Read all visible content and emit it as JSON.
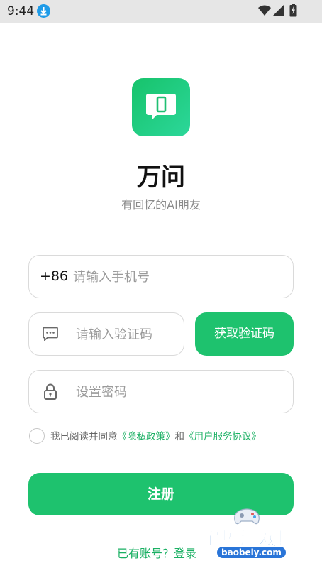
{
  "status_bar": {
    "time": "9:44",
    "download_icon": "download-circle-icon",
    "wifi_icon": "wifi-icon",
    "signal_icon": "signal-icon",
    "battery_icon": "battery-charging-icon"
  },
  "app": {
    "name": "万问",
    "slogan": "有回忆的AI朋友",
    "logo_icon": "chat-phone-logo-icon",
    "brand_color": "#1ec26e"
  },
  "form": {
    "country_code": "+86",
    "phone_placeholder": "请输入手机号",
    "code_placeholder": "请输入验证码",
    "get_code_label": "获取验证码",
    "password_placeholder": "设置密码",
    "agreement": {
      "prefix": "我已阅读并同意",
      "privacy": "《隐私政策》",
      "and": "和",
      "terms": "《用户服务协议》",
      "checked": false
    },
    "register_label": "注册",
    "login_link": "已有账号？登录"
  },
  "watermark": {
    "title": "宝贝游戏网",
    "url": "baobeiy.com"
  }
}
